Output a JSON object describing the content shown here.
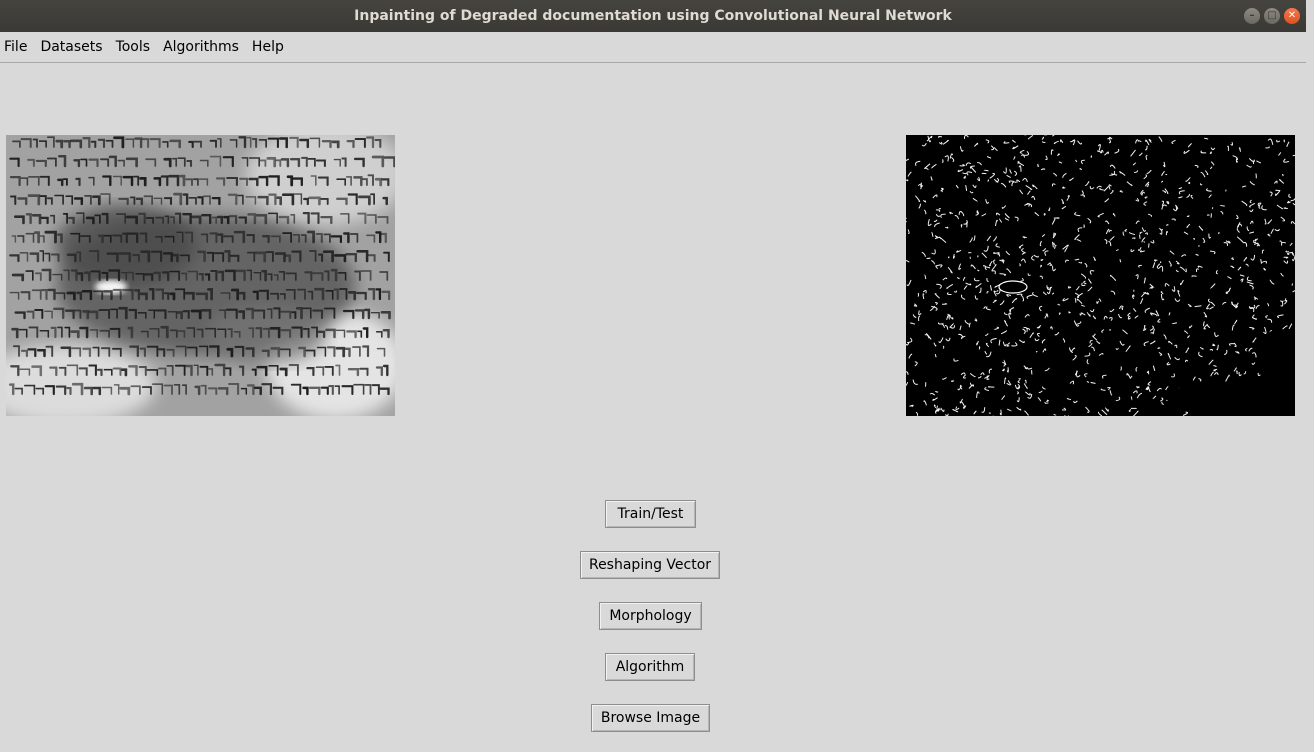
{
  "window": {
    "title": "Inpainting of Degraded documentation using Convolutional Neural Network",
    "controls": [
      "minimize-icon",
      "maximize-icon",
      "close-icon"
    ]
  },
  "menubar": {
    "items": [
      "File",
      "Datasets",
      "Tools",
      "Algorithms",
      "Help"
    ]
  },
  "images": {
    "original": "degraded-manuscript-image",
    "processed": "edge-map-image"
  },
  "buttons": {
    "train_test": "Train/Test",
    "reshaping_vector": "Reshaping Vector",
    "morphology": "Morphology",
    "algorithm": "Algorithm",
    "browse_image": "Browse Image"
  },
  "colors": {
    "window_bg": "#d9d9d9",
    "titlebar_bg": "#3c3b37",
    "close_button": "#e95420"
  }
}
